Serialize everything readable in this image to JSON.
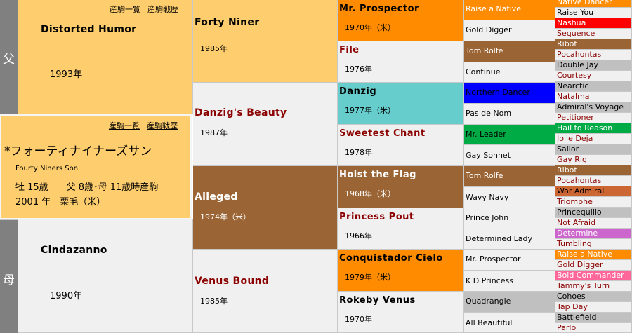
{
  "side": {
    "sire": "父",
    "dam": "母"
  },
  "subject": {
    "links": [
      "産駒一覧",
      "産駒戦歴"
    ],
    "name": "*フォーティナイナーズサン",
    "en_name": "Fourty Niners Son",
    "line1": "牡 15歳　　父 8歳･母 11歳時産駒",
    "line2": "2001 年　栗毛（米）"
  },
  "sire": {
    "name": "Distorted Humor",
    "year": "1993年",
    "links": [
      "産駒一覧",
      "産駒戦歴"
    ]
  },
  "dam": {
    "name": "Cindazanno",
    "year": "1990年"
  },
  "gen2": [
    {
      "name": "Forty Niner",
      "year": "1985年"
    },
    {
      "name": "Danzig's Beauty",
      "year": "1987年"
    },
    {
      "name": "Alleged",
      "year": "1974年（米）"
    },
    {
      "name": "Venus Bound",
      "year": "1985年"
    }
  ],
  "gen3": [
    {
      "name": "Mr. Prospector",
      "year": "1970年（米）"
    },
    {
      "name": "File",
      "year": "1976年"
    },
    {
      "name": "Danzig",
      "year": "1977年（米）"
    },
    {
      "name": "Sweetest Chant",
      "year": "1978年"
    },
    {
      "name": "Hoist the Flag",
      "year": "1968年（米）"
    },
    {
      "name": "Princess Pout",
      "year": "1966年"
    },
    {
      "name": "Conquistador Cielo",
      "year": "1979年（米）"
    },
    {
      "name": "Rokeby Venus",
      "year": "1970年"
    }
  ],
  "gen4": [
    "Raise a Native",
    "Gold Digger",
    "Tom Rolfe",
    "Continue",
    "Northern Dancer",
    "Pas de Nom",
    "Mr. Leader",
    "Gay Sonnet",
    "Tom Rolfe",
    "Wavy Navy",
    "Prince John",
    "Determined Lady",
    "Mr. Prospector",
    "K D Princess",
    "Quadrangle",
    "All Beautiful"
  ],
  "gen5": [
    "Native Dancer",
    "Raise You",
    "Nashua",
    "Sequence",
    "Ribot",
    "Pocahontas",
    "Double Jay",
    "Courtesy",
    "Nearctic",
    "Natalma",
    "Admiral's Voyage",
    "Petitioner",
    "Hail to Reason",
    "Jolie Deja",
    "Sailor",
    "Gay Rig",
    "Ribot",
    "Pocahontas",
    "War Admiral",
    "Triomphe",
    "Princequillo",
    "Not Afraid",
    "Determine",
    "Tumbling",
    "Raise a Native",
    "Gold Digger",
    "Bold Commander",
    "Tammy's Turn",
    "Cohoes",
    "Tap Day",
    "Battlefield",
    "Parlo"
  ],
  "colors": {
    "orange": "#fece6e",
    "grey": "#f0f0f0",
    "brown": "#9a6434",
    "dark_orange": "#ff8c00",
    "teal": "#66cccc",
    "blue": "#0000ff",
    "green": "#00aa44",
    "red": "#ff0000",
    "rust": "#cc6633",
    "pink": "#ff6699",
    "purple": "#cc66cc",
    "silver": "#c0c0c0",
    "side": "#808080"
  }
}
